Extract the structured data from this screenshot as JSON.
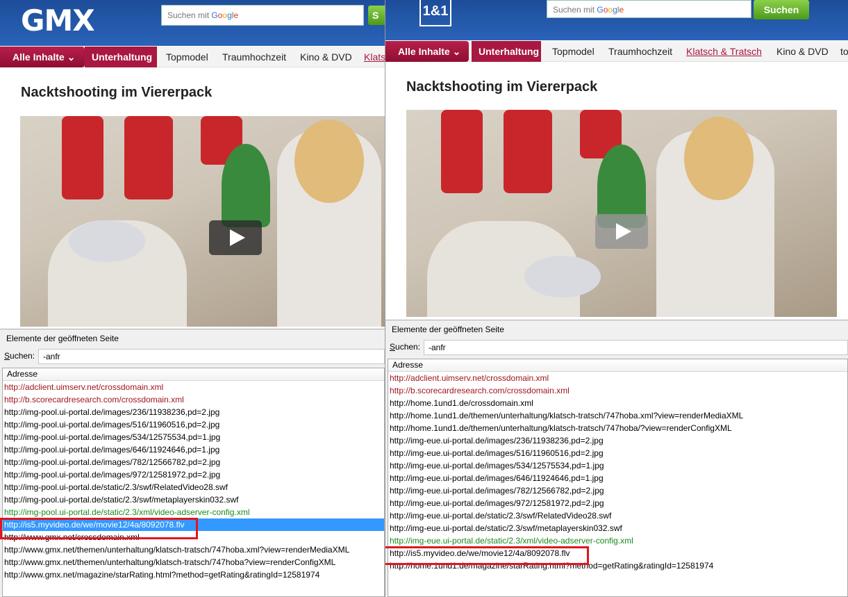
{
  "left": {
    "logo": "GMX",
    "search": {
      "placeholder": "Suchen mit",
      "google": "Google",
      "button": "S"
    },
    "nav": {
      "all": "Alle Inhalte",
      "category": "Unterhaltung",
      "items": [
        "Topmodel",
        "Traumhochzeit",
        "Kino & DVD",
        "Klats"
      ]
    },
    "title": "Nacktshooting im Viererpack",
    "panel": {
      "title": "Elemente der geöffneten Seite",
      "search_label": "uchen:",
      "search_underline": "S",
      "search_value": "-anfr",
      "column": "Adresse",
      "rows": [
        "http://adclient.uimserv.net/crossdomain.xml",
        "http://b.scorecardresearch.com/crossdomain.xml",
        "http://img-pool.ui-portal.de/images/236/11938236,pd=2.jpg",
        "http://img-pool.ui-portal.de/images/516/11960516,pd=2.jpg",
        "http://img-pool.ui-portal.de/images/534/12575534,pd=1.jpg",
        "http://img-pool.ui-portal.de/images/646/11924646,pd=1.jpg",
        "http://img-pool.ui-portal.de/images/782/12566782,pd=2.jpg",
        "http://img-pool.ui-portal.de/images/972/12581972,pd=2.jpg",
        "http://img-pool.ui-portal.de/static/2.3/swf/RelatedVideo28.swf",
        "http://img-pool.ui-portal.de/static/2.3/swf/metaplayerskin032.swf",
        "http://img-pool.ui-portal.de/static/2.3/xml/video-adserver-config.xml",
        "http://is5.myvideo.de/we/movie12/4a/8092078.flv",
        "http://www.gmx.net/crossdomain.xml",
        "http://www.gmx.net/themen/unterhaltung/klatsch-tratsch/747hoba.xml?view=renderMediaXML",
        "http://www.gmx.net/themen/unterhaltung/klatsch-tratsch/747hoba?view=renderConfigXML",
        "http://www.gmx.net/magazine/starRating.html?method=getRating&ratingId=12581974"
      ]
    }
  },
  "right": {
    "logo": "1&1",
    "search": {
      "placeholder": "Suchen mit",
      "google": "Google",
      "button": "Suchen"
    },
    "nav": {
      "all": "Alle Inhalte",
      "category": "Unterhaltung",
      "items": [
        "Topmodel",
        "Traumhochzeit",
        "Klatsch & Tratsch",
        "Kino & DVD",
        "to"
      ]
    },
    "title": "Nacktshooting im Viererpack",
    "panel": {
      "title": "Elemente der geöffneten Seite",
      "search_label": "uchen:",
      "search_underline": "S",
      "search_value": "-anfr",
      "column": "Adresse",
      "rows": [
        "http://adclient.uimserv.net/crossdomain.xml",
        "http://b.scorecardresearch.com/crossdomain.xml",
        "http://home.1und1.de/crossdomain.xml",
        "http://home.1und1.de/themen/unterhaltung/klatsch-tratsch/747hoba.xml?view=renderMediaXML",
        "http://home.1und1.de/themen/unterhaltung/klatsch-tratsch/747hoba/?view=renderConfigXML",
        "http://img-eue.ui-portal.de/images/236/11938236,pd=2.jpg",
        "http://img-eue.ui-portal.de/images/516/11960516,pd=2.jpg",
        "http://img-eue.ui-portal.de/images/534/12575534,pd=1.jpg",
        "http://img-eue.ui-portal.de/images/646/11924646,pd=1.jpg",
        "http://img-eue.ui-portal.de/images/782/12566782,pd=2.jpg",
        "http://img-eue.ui-portal.de/images/972/12581972,pd=2.jpg",
        "http://img-eue.ui-portal.de/static/2.3/swf/RelatedVideo28.swf",
        "http://img-eue.ui-portal.de/static/2.3/swf/metaplayerskin032.swf",
        "http://img-eue.ui-portal.de/static/2.3/xml/video-adserver-config.xml",
        "http://is5.myvideo.de/we/movie12/4a/8092078.flv",
        "http://home.1und1.de/magazine/starRating.html?method=getRating&ratingId=12581974"
      ]
    }
  },
  "colors": {
    "header_blue": "#2a63b8",
    "brand_red": "#a81840",
    "link_red": "#a0141e",
    "link_green": "#1a8a1a",
    "selection": "#3399ff",
    "highlight_box": "#e01520"
  }
}
